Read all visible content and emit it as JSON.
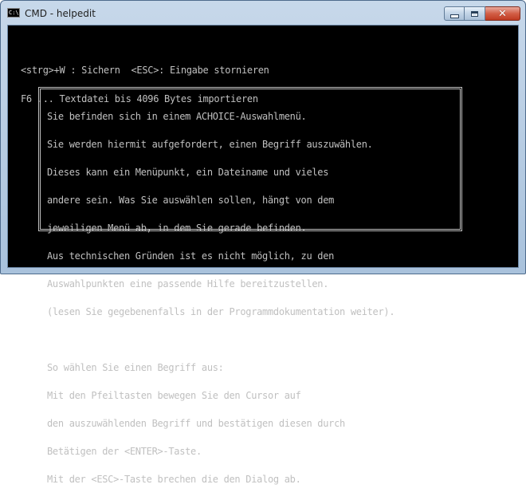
{
  "window": {
    "title": "CMD - helpedit",
    "app_icon_glyph": "C:\\",
    "buttons": {
      "minimize": "minimize",
      "maximize": "maximize",
      "close": "close",
      "close_glyph": "✕"
    }
  },
  "console": {
    "hints": [
      "<strg>+W : Sichern  <ESC>: Eingabe stornieren",
      "F6 ... Textdatei bis 4096 Bytes importieren"
    ],
    "dialog": {
      "paragraph1": [
        "Sie befinden sich in einem ACHOICE-Auswahlmenü.",
        "Sie werden hiermit aufgefordert, einen Begriff auszuwählen.",
        "Dieses kann ein Menüpunkt, ein Dateiname und vieles",
        "andere sein. Was Sie auswählen sollen, hängt von dem",
        "jeweiligen Menü ab, in dem Sie gerade befinden.",
        "Aus technischen Gründen ist es nicht möglich, zu den",
        "Auswahlpunkten eine passende Hilfe bereitzustellen.",
        "(lesen Sie gegebenenfalls in der Programmdokumentation weiter)."
      ],
      "paragraph2": [
        "So wählen Sie einen Begriff aus:",
        "Mit den Pfeiltasten bewegen Sie den Cursor auf",
        "den auszuwählenden Begriff und bestätigen diesen durch",
        "Betätigen der <ENTER>-Taste.",
        "Mit der <ESC>-Taste brechen die den Dialog ab."
      ]
    }
  },
  "colors": {
    "console_bg": "#000000",
    "console_text": "#c0c0c0",
    "close_button": "#c94a31"
  }
}
